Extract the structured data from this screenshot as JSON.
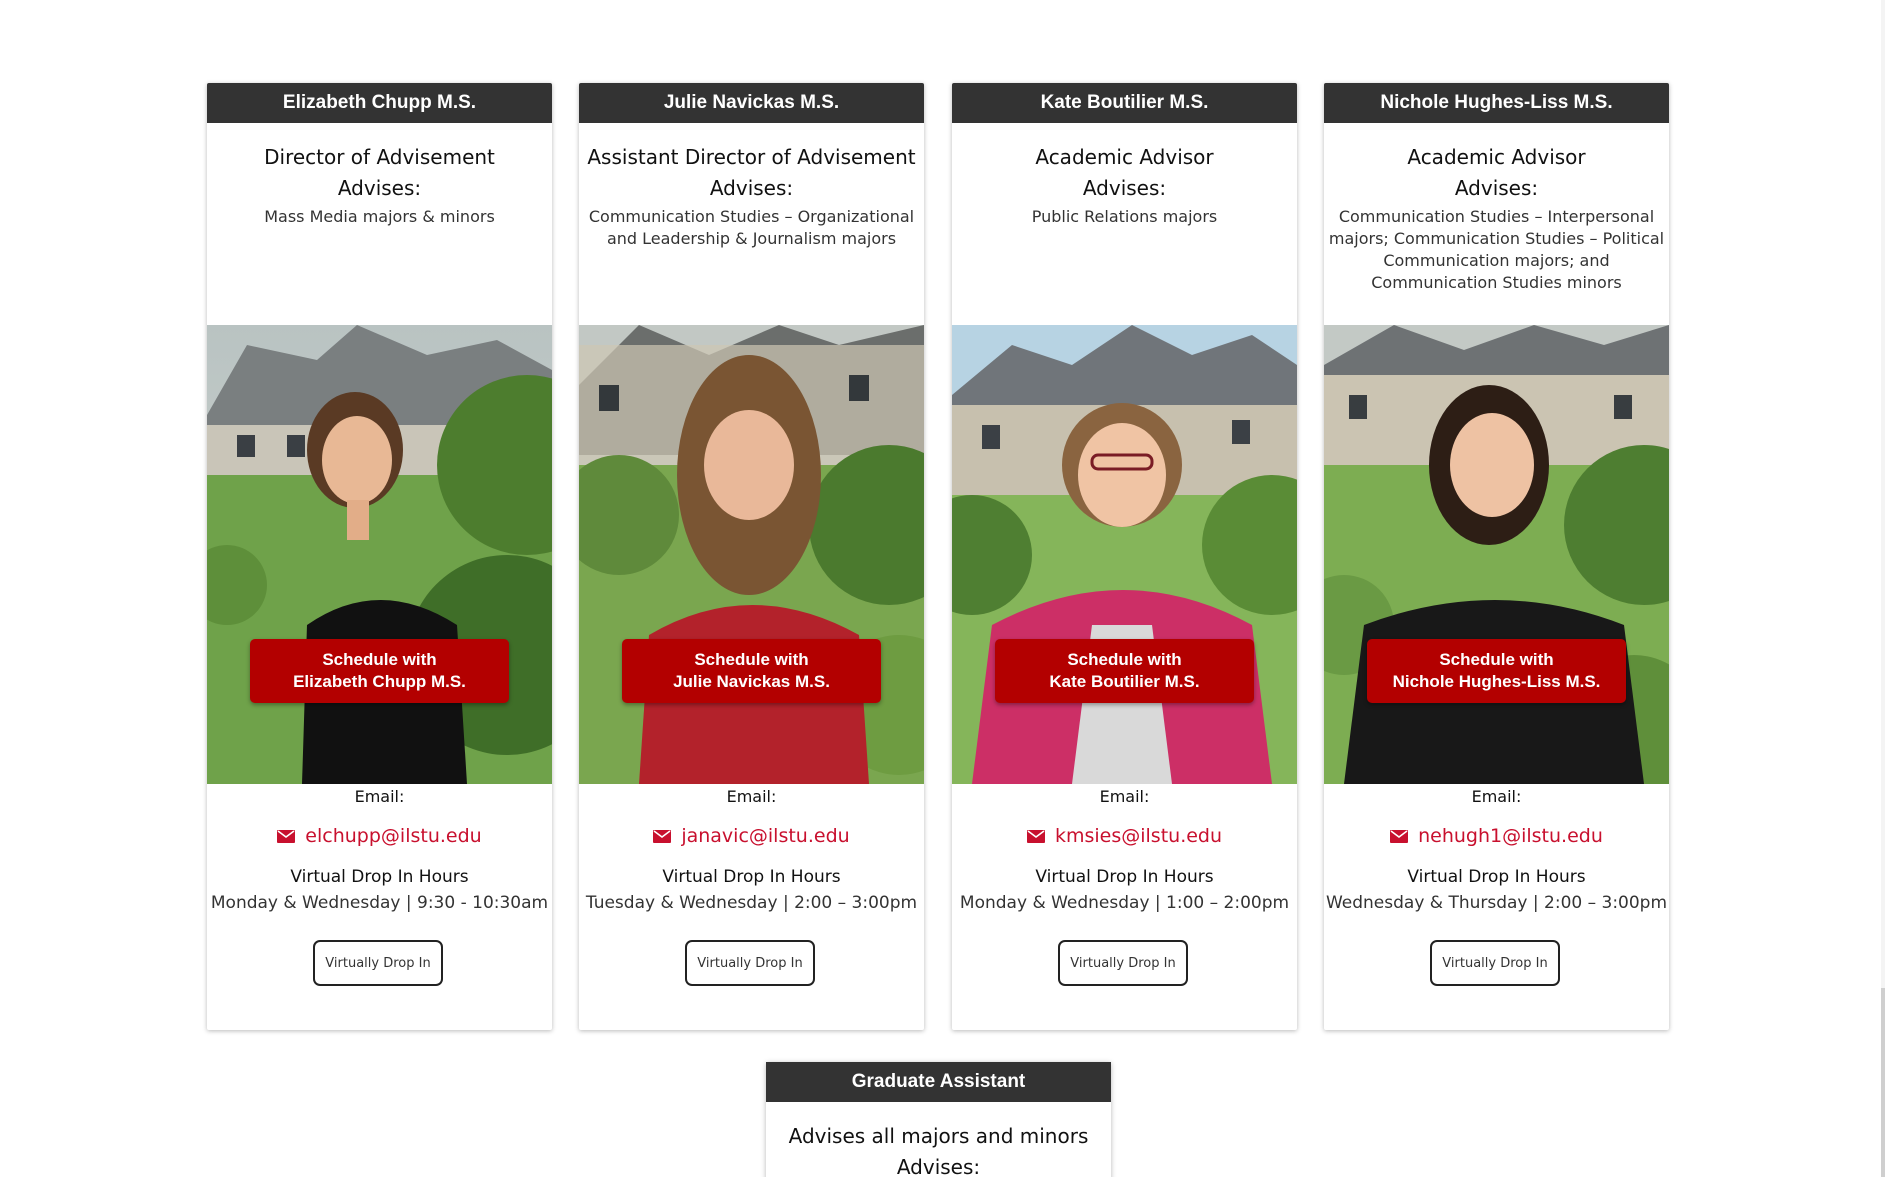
{
  "colors": {
    "header_bg": "#333333",
    "accent_red": "#b30000",
    "link_red": "#c8102e",
    "card_bg": "#ffffff"
  },
  "advisors": [
    {
      "name": "Elizabeth Chupp M.S.",
      "role": "Director of Advisement",
      "advises_label": "Advises:",
      "advises": "Mass Media majors & minors",
      "schedule_line1": "Schedule with",
      "schedule_line2": "Elizabeth Chupp M.S.",
      "email_label": "Email:",
      "email": "elchupp@ilstu.edu",
      "hours_title": "Virtual Drop In Hours",
      "hours": "Monday & Wednesday | 9:30 - 10:30am",
      "dropin_label": "Virtually Drop In",
      "photo": {
        "top": "black-sleeveless",
        "hair": "short-brown"
      }
    },
    {
      "name": "Julie Navickas M.S.",
      "role": "Assistant Director of Advisement",
      "advises_label": "Advises:",
      "advises": "Communication Studies – Organizational and Leadership & Journalism majors",
      "schedule_line1": "Schedule with",
      "schedule_line2": "Julie Navickas M.S.",
      "email_label": "Email:",
      "email": "janavic@ilstu.edu",
      "hours_title": "Virtual Drop In Hours",
      "hours": "Tuesday & Wednesday | 2:00 – 3:00pm",
      "dropin_label": "Virtually Drop In",
      "photo": {
        "top": "red-shirt",
        "hair": "long-brown"
      }
    },
    {
      "name": "Kate Boutilier M.S.",
      "role": "Academic Advisor",
      "advises_label": "Advises:",
      "advises": "Public Relations majors",
      "schedule_line1": "Schedule with",
      "schedule_line2": "Kate Boutilier M.S.",
      "email_label": "Email:",
      "email": "kmsies@ilstu.edu",
      "hours_title": "Virtual Drop In Hours",
      "hours": "Monday & Wednesday | 1:00 – 2:00pm",
      "dropin_label": "Virtually Drop In",
      "photo": {
        "top": "pink-cardigan",
        "hair": "short-light-brown"
      }
    },
    {
      "name": "Nichole Hughes-Liss M.S.",
      "role": "Academic Advisor",
      "advises_label": "Advises:",
      "advises": "Communication Studies – Interpersonal majors; Communication Studies – Political Communication majors; and Communication Studies minors",
      "schedule_line1": "Schedule with",
      "schedule_line2": "Nichole Hughes-Liss M.S.",
      "email_label": "Email:",
      "email": "nehugh1@ilstu.edu",
      "hours_title": "Virtual Drop In Hours",
      "hours": "Wednesday & Thursday | 2:00 – 3:00pm",
      "dropin_label": "Virtually Drop In",
      "photo": {
        "top": "black-blouse",
        "hair": "dark-brown"
      }
    }
  ],
  "graduate_assistant": {
    "header": "Graduate Assistant",
    "role": "Advises all majors and minors",
    "advises_label": "Advises:"
  }
}
